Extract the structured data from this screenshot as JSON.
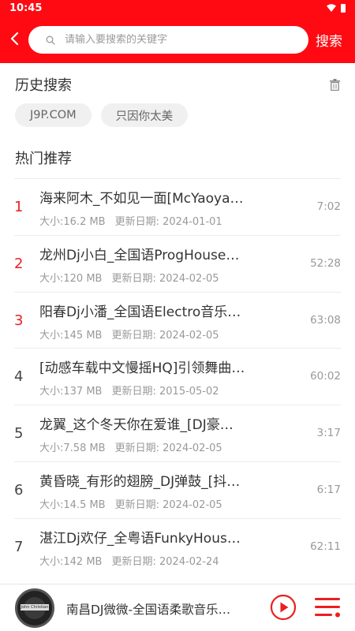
{
  "status": {
    "time": "10:45"
  },
  "search": {
    "placeholder": "请输入要搜索的关键字",
    "value": "",
    "button": "搜索"
  },
  "history": {
    "title": "历史搜索",
    "items": [
      "J9P.COM",
      "只因你太美"
    ]
  },
  "hot": {
    "title": "热门推荐",
    "size_prefix": "大小:",
    "date_prefix": "更新日期: ",
    "items": [
      {
        "rank": "1",
        "title": "海来阿木_不如见一面[McYaoya…",
        "size": "16.2 MB",
        "date": "2024-01-01",
        "duration": "7:02"
      },
      {
        "rank": "2",
        "title": "龙州Dj小白_全国语ProgHouse…",
        "size": "120 MB",
        "date": "2024-02-05",
        "duration": "52:28"
      },
      {
        "rank": "3",
        "title": "阳春Dj小潘_全国语Electro音乐…",
        "size": "145 MB",
        "date": "2024-02-05",
        "duration": "63:08"
      },
      {
        "rank": "4",
        "title": "[动感车载中文慢摇HQ]引领舞曲…",
        "size": "137 MB",
        "date": "2015-05-02",
        "duration": "60:02"
      },
      {
        "rank": "5",
        "title": "龙翼_这个冬天你在爱谁_[DJ豪…",
        "size": "7.58 MB",
        "date": "2024-02-05",
        "duration": "3:17"
      },
      {
        "rank": "6",
        "title": "黄昏晓_有形的翅膀_DJ弹鼓_[抖…",
        "size": "14.5 MB",
        "date": "2024-02-05",
        "duration": "6:17"
      },
      {
        "rank": "7",
        "title": "湛江Dj欢仔_全粤语FunkyHous…",
        "size": "142 MB",
        "date": "2024-02-24",
        "duration": "62:11"
      }
    ]
  },
  "player": {
    "cover_text": "John Christian",
    "now_playing": "南昌DJ微微-全国语柔歌音乐…"
  },
  "colors": {
    "accent": "#ff0a12",
    "rank_hot": "#ea1f1f"
  }
}
